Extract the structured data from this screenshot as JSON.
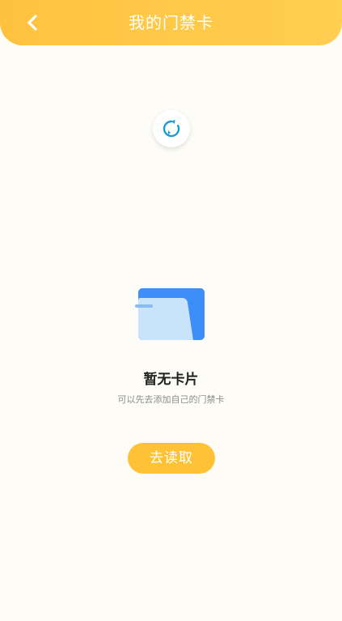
{
  "header": {
    "title": "我的门禁卡",
    "back_icon": "chevron-left-icon"
  },
  "refresh": {
    "icon": "refresh-icon",
    "icon_color": "#1a9ad6"
  },
  "empty_state": {
    "illustration": "card-icon",
    "title": "暂无卡片",
    "subtitle": "可以先去添加自己的门禁卡"
  },
  "actions": {
    "read_label": "去读取"
  },
  "colors": {
    "accent": "#ffc236",
    "background": "#fdfcf6",
    "card_blue": "#3d8ef8",
    "card_light": "#cfe6fb"
  }
}
